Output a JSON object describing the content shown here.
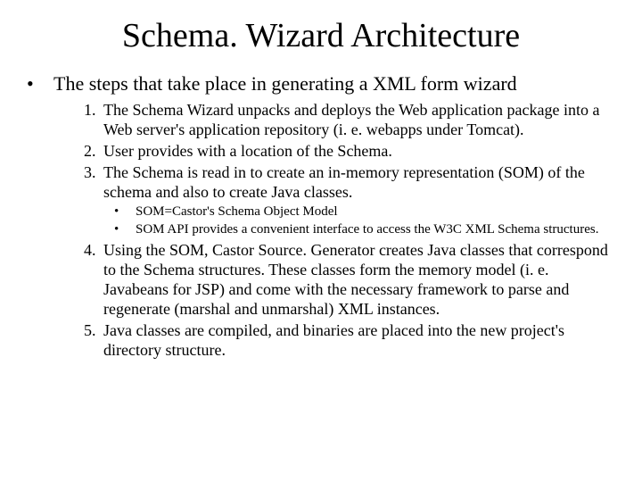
{
  "title": "Schema. Wizard Architecture",
  "intro_bullet": "•",
  "intro": "The steps that take place in generating a XML form wizard",
  "steps": {
    "s1": "The Schema Wizard unpacks and deploys the Web application package into a Web server's application repository (i. e. webapps under Tomcat).",
    "s2": "User provides with a location of the Schema.",
    "s3": "The Schema is read in to create an in-memory representation (SOM) of the schema and also to create Java classes.",
    "s3_sub1": "SOM=Castor's Schema Object Model",
    "s3_sub2": "SOM API provides a convenient interface to access the W3C XML Schema structures.",
    "s4": "Using the SOM, Castor Source. Generator creates Java classes that correspond to the Schema structures. These classes form the memory model (i. e. Javabeans for JSP) and come with the necessary framework to parse and regenerate (marshal and unmarshal) XML instances.",
    "s5": "Java classes are compiled, and binaries are placed into the new project's directory structure."
  }
}
